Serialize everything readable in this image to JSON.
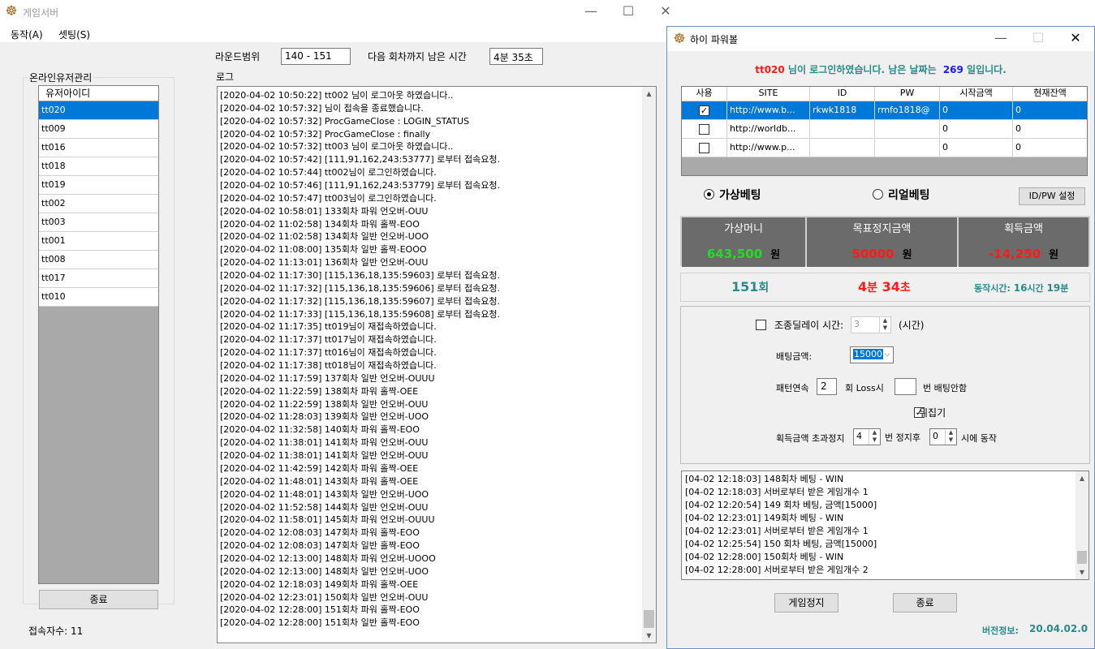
{
  "main_window": {
    "title": "게임서버",
    "menu": [
      "동작(A)",
      "셋팅(S)"
    ],
    "round_range_label": "라운드범위",
    "round_range_value": "140 - 151",
    "time_left_label": "다음 회차까지 남은 시간",
    "time_left_value": "4분 35초",
    "log_label": "로그",
    "users_group_title": "온라인유저관리",
    "users_header": "유저아이디",
    "users": [
      "tt020",
      "tt009",
      "tt016",
      "tt018",
      "tt019",
      "tt002",
      "tt003",
      "tt001",
      "tt008",
      "tt017",
      "tt010"
    ],
    "selected_user_index": 0,
    "exit_button": "종료",
    "connected_count": "접속자수: 11",
    "log_lines": [
      "[2020-04-02 10:50:22] tt002 님이 로그아웃 하였습니다..",
      "[2020-04-02 10:57:32] 님이 접속을 종료했습니다.",
      "[2020-04-02 10:57:32] ProcGameClose : LOGIN_STATUS",
      "[2020-04-02 10:57:32] ProcGameClose : finally",
      "[2020-04-02 10:57:32] tt003 님이 로그아웃 하였습니다..",
      "[2020-04-02 10:57:42] [111,91,162,243:53777] 로부터 접속요청.",
      "[2020-04-02 10:57:44] tt002님이 로그인하였습니다.",
      "[2020-04-02 10:57:46] [111,91,162,243:53779] 로부터 접속요청.",
      "[2020-04-02 10:57:47] tt003님이 로그인하였습니다.",
      "[2020-04-02 10:58:01] 133회차 파워 언오버-OUU",
      "[2020-04-02 11:02:58] 134회차 파워 홀짝-EOO",
      "[2020-04-02 11:02:58] 134회차 일반 언오버-UOO",
      "[2020-04-02 11:08:00] 135회차 일반 홀짝-EOOO",
      "[2020-04-02 11:13:01] 136회차 일반 언오버-OUU",
      "[2020-04-02 11:17:30] [115,136,18,135:59603] 로부터 접속요청.",
      "[2020-04-02 11:17:32] [115,136,18,135:59606] 로부터 접속요청.",
      "[2020-04-02 11:17:32] [115,136,18,135:59607] 로부터 접속요청.",
      "[2020-04-02 11:17:33] [115,136,18,135:59608] 로부터 접속요청.",
      "[2020-04-02 11:17:35] tt019님이 재접속하였습니다.",
      "[2020-04-02 11:17:37] tt017님이 재접속하였습니다.",
      "[2020-04-02 11:17:37] tt016님이 재접속하였습니다.",
      "[2020-04-02 11:17:38] tt018님이 재접속하였습니다.",
      "[2020-04-02 11:17:59] 137회차 일반 언오버-OUUU",
      "[2020-04-02 11:22:59] 138회차 파워 홀짝-OEE",
      "[2020-04-02 11:22:59] 138회차 일반 언오버-OUU",
      "[2020-04-02 11:28:03] 139회차 일반 언오버-UOO",
      "[2020-04-02 11:32:58] 140회차 파워 홀짝-EOO",
      "[2020-04-02 11:38:01] 141회차 파워 언오버-OUU",
      "[2020-04-02 11:38:01] 141회차 일반 언오버-OUU",
      "[2020-04-02 11:42:59] 142회차 파워 홀짝-OEE",
      "[2020-04-02 11:48:01] 143회차 파워 홀짝-OEE",
      "[2020-04-02 11:48:01] 143회차 일반 언오버-UOO",
      "[2020-04-02 11:52:58] 144회차 일반 언오버-OUU",
      "[2020-04-02 11:58:01] 145회차 파워 언오버-OUUU",
      "[2020-04-02 12:08:03] 147회차 파워 홀짝-EOO",
      "[2020-04-02 12:08:03] 147회차 일반 홀짝-EOO",
      "[2020-04-02 12:13:00] 148회차 파워 언오버-UOOO",
      "[2020-04-02 12:13:00] 148회차 일반 언오버-UOO",
      "[2020-04-02 12:18:03] 149회차 파워 홀짝-OEE",
      "[2020-04-02 12:23:01] 150회차 일반 언오버-OUU",
      "[2020-04-02 12:28:00] 151회차 파워 홀짝-EOO",
      "[2020-04-02 12:28:00] 151회차 일반 홀짝-EOO"
    ]
  },
  "client_window": {
    "title": "하이 파워볼",
    "login_user": "tt020",
    "login_msg": " 님이 로그인하였습니다. 남은 날짜는 ",
    "days_left": "269",
    "days_suffix": "   일입니다.",
    "grid_headers": [
      "사용",
      "SITE",
      "ID",
      "PW",
      "시작금액",
      "현재잔액"
    ],
    "grid_rows": [
      {
        "use": true,
        "site": "http://www.b...",
        "id": "rkwk1818",
        "pw": "rmfo1818@",
        "start": "0",
        "balance": "0"
      },
      {
        "use": false,
        "site": "http://worldb...",
        "id": "",
        "pw": "",
        "start": "0",
        "balance": "0"
      },
      {
        "use": false,
        "site": "http://www.p...",
        "id": "",
        "pw": "",
        "start": "0",
        "balance": "0"
      }
    ],
    "virtual_bet_label": "가상베팅",
    "real_bet_label": "리얼베팅",
    "idpw_button": "ID/PW 설정",
    "stat_headers": [
      "가상머니",
      "목표정지금액",
      "획득금액"
    ],
    "virtual_money": "643,500",
    "target_stop": "50000",
    "earned": "-14,250",
    "unit_won": "원",
    "round_no": "151",
    "round_suffix": "회",
    "remain_min": "4",
    "remain_min_unit": "분",
    "remain_sec": "34",
    "remain_sec_unit": "초",
    "uptime_label": "동작시간: ",
    "uptime_h": "16",
    "uptime_h_unit": "시간",
    "uptime_m": "19",
    "uptime_m_unit": "분",
    "delay_label": "조종딜레이 시간:",
    "delay_value": "3",
    "delay_unit": "(시간)",
    "bet_amount_label": "배팅금액:",
    "bet_amount_value": "15000",
    "pattern_label": "패턴연속",
    "pattern_value": "2",
    "loss_label": "회 Loss시",
    "loss_value": "",
    "no_bet_label": "번 배팅안함",
    "flip_label": "뒤집기",
    "earn_stop_label": "획득금액 초과정지",
    "earn_stop_value": "4",
    "stop_after_label": "번 정지후",
    "resume_value": "0",
    "resume_label": "시에 동작",
    "bet_log": [
      "[04-02 12:18:03] 148회차 베팅 - WIN",
      "[04-02 12:18:03] 서버로부터 받은 게임개수 1",
      "[04-02 12:20:54]  149 회차 베팅, 금액[15000]",
      "[04-02 12:23:01] 149회차 베팅 - WIN",
      "[04-02 12:23:01] 서버로부터 받은 게임개수 1",
      "[04-02 12:25:54]  150 회차 베팅, 금액[15000]",
      "[04-02 12:28:00] 150회차 베팅 - WIN",
      "[04-02 12:28:00] 서버로부터 받은 게임개수 2"
    ],
    "stop_button": "게임정지",
    "exit_button": "종료",
    "version_label": "버전정보:",
    "version_value": "20.04.02.0",
    "colors": {
      "teal": "#2a8a8a",
      "green": "#22dd22",
      "red": "#ff1a1a",
      "blue": "#1a1aff"
    }
  }
}
